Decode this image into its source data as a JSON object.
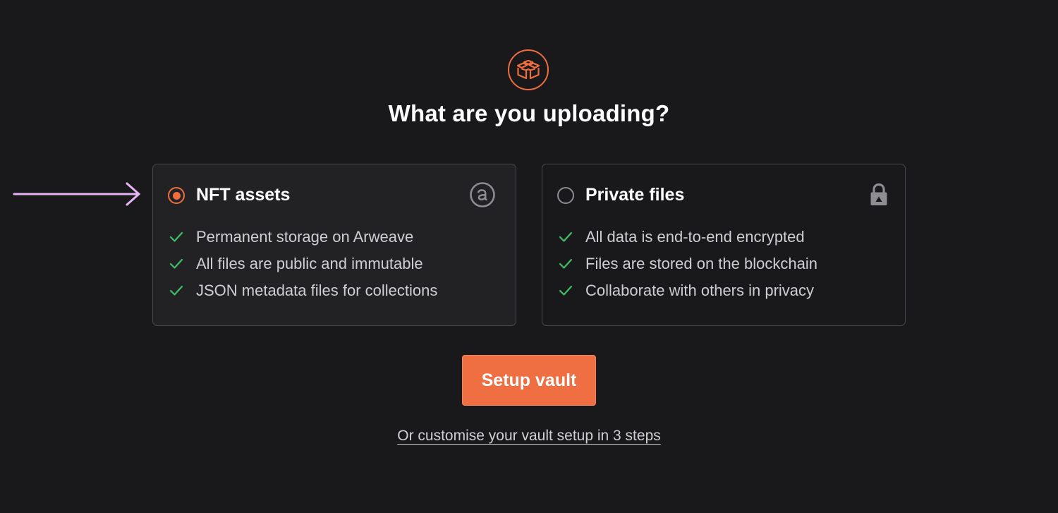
{
  "header": {
    "logo_icon": "vault-box-icon",
    "title": "What are you uploading?"
  },
  "options": [
    {
      "title": "NFT assets",
      "selected": true,
      "icon": "arweave-icon",
      "features": [
        "Permanent storage on Arweave",
        "All files are public and immutable",
        "JSON metadata files for collections"
      ]
    },
    {
      "title": "Private files",
      "selected": false,
      "icon": "lock-icon",
      "features": [
        "All data is end-to-end encrypted",
        "Files are stored on the blockchain",
        "Collaborate with others in privacy"
      ]
    }
  ],
  "actions": {
    "setup_label": "Setup vault",
    "customise_link": "Or customise your vault setup in 3 steps"
  },
  "colors": {
    "accent": "#ef6e42",
    "background": "#19191b",
    "check": "#3fbf6a",
    "annotation_arrow": "#e6b4f2"
  }
}
